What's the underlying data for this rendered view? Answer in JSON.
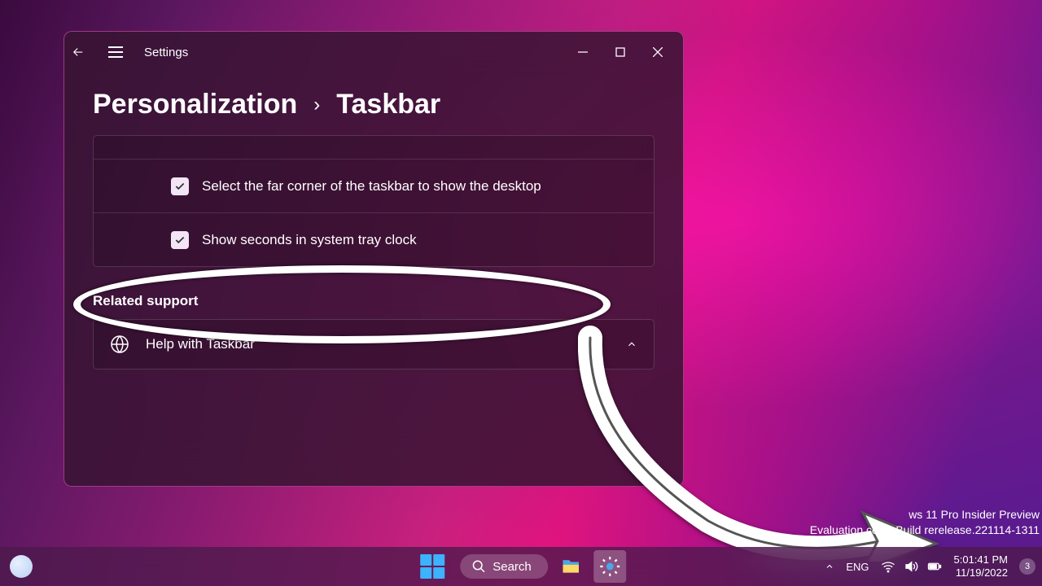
{
  "window": {
    "app_title": "Settings",
    "breadcrumb_parent": "Personalization",
    "breadcrumb_separator": "›",
    "breadcrumb_current": "Taskbar"
  },
  "settings": {
    "items": [
      {
        "label": "Select the far corner of the taskbar to show the desktop",
        "checked": true
      },
      {
        "label": "Show seconds in system tray clock",
        "checked": true
      }
    ]
  },
  "related_support": {
    "header": "Related support",
    "help_item": "Help with Taskbar"
  },
  "watermark": {
    "line1": "ws 11 Pro Insider Preview",
    "line2": "Evaluation copy. Build                       rerelease.221114-1311"
  },
  "taskbar": {
    "search_label": "Search",
    "language": "ENG",
    "clock_time": "5:01:41 PM",
    "clock_date": "11/19/2022",
    "notification_count": "3"
  }
}
